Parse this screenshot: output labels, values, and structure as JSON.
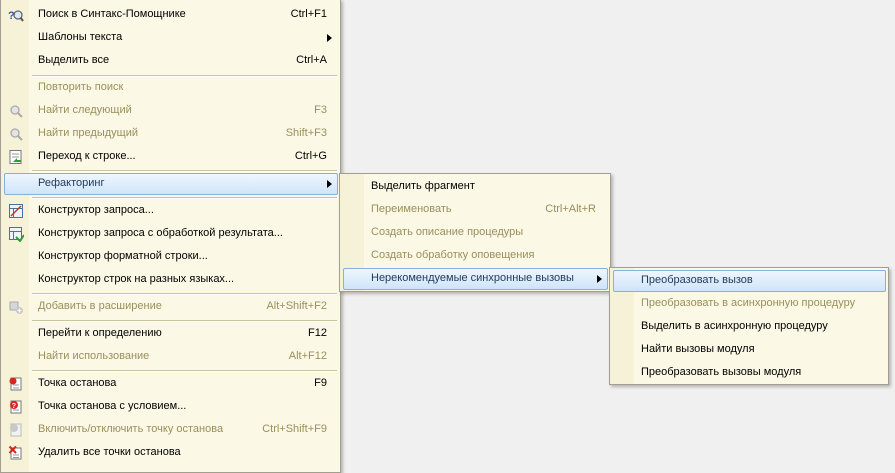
{
  "colors": {
    "menu_bg": "#fbf8e6",
    "highlight": "#cfe4f9",
    "disabled_text": "#9a8f5c"
  },
  "main_menu": {
    "items": [
      {
        "label": "Поиск в Синтакс-Помощнике",
        "shortcut": "Ctrl+F1",
        "icon": "search-help-icon"
      },
      {
        "label": "Шаблоны текста",
        "shortcut": "",
        "submenu": true
      },
      {
        "label": "Выделить все",
        "shortcut": "Ctrl+A"
      },
      {
        "label": "Повторить поиск",
        "shortcut": "",
        "disabled": true
      },
      {
        "label": "Найти следующий",
        "shortcut": "F3",
        "disabled": true,
        "icon": "find-next-icon"
      },
      {
        "label": "Найти предыдущий",
        "shortcut": "Shift+F3",
        "disabled": true,
        "icon": "find-previous-icon"
      },
      {
        "label": "Переход к строке...",
        "shortcut": "Ctrl+G",
        "icon": "goto-line-icon"
      },
      {
        "label": "Рефакторинг",
        "shortcut": "",
        "submenu": true,
        "highlighted": true
      },
      {
        "label": "Конструктор запроса...",
        "shortcut": "",
        "icon": "query-builder-icon"
      },
      {
        "label": "Конструктор запроса с обработкой результата...",
        "shortcut": "",
        "icon": "query-builder-result-icon"
      },
      {
        "label": "Конструктор форматной строки...",
        "shortcut": ""
      },
      {
        "label": "Конструктор строк на разных языках...",
        "shortcut": ""
      },
      {
        "label": "Добавить в расширение",
        "shortcut": "Alt+Shift+F2",
        "disabled": true,
        "icon": "add-extension-icon"
      },
      {
        "label": "Перейти к определению",
        "shortcut": "F12"
      },
      {
        "label": "Найти использование",
        "shortcut": "Alt+F12",
        "disabled": true
      },
      {
        "label": "Точка останова",
        "shortcut": "F9",
        "icon": "breakpoint-icon"
      },
      {
        "label": "Точка останова с условием...",
        "shortcut": "",
        "icon": "conditional-breakpoint-icon"
      },
      {
        "label": "Включить/отключить точку останова",
        "shortcut": "Ctrl+Shift+F9",
        "disabled": true,
        "icon": "toggle-breakpoint-icon"
      },
      {
        "label": "Удалить все точки останова",
        "shortcut": "",
        "icon": "delete-breakpoints-icon"
      }
    ]
  },
  "refactoring_menu": {
    "items": [
      {
        "label": "Выделить фрагмент",
        "shortcut": ""
      },
      {
        "label": "Переименовать",
        "shortcut": "Ctrl+Alt+R",
        "disabled": true
      },
      {
        "label": "Создать описание процедуры",
        "shortcut": "",
        "disabled": true
      },
      {
        "label": "Создать обработку оповещения",
        "shortcut": "",
        "disabled": true
      },
      {
        "label": "Нерекомендуемые синхронные вызовы",
        "shortcut": "",
        "submenu": true,
        "highlighted": true
      }
    ]
  },
  "sync_calls_menu": {
    "items": [
      {
        "label": "Преобразовать вызов",
        "highlighted": true
      },
      {
        "label": "Преобразовать в асинхронную процедуру",
        "disabled": true
      },
      {
        "label": "Выделить в асинхронную процедуру"
      },
      {
        "label": "Найти вызовы модуля"
      },
      {
        "label": "Преобразовать вызовы модуля"
      }
    ]
  }
}
